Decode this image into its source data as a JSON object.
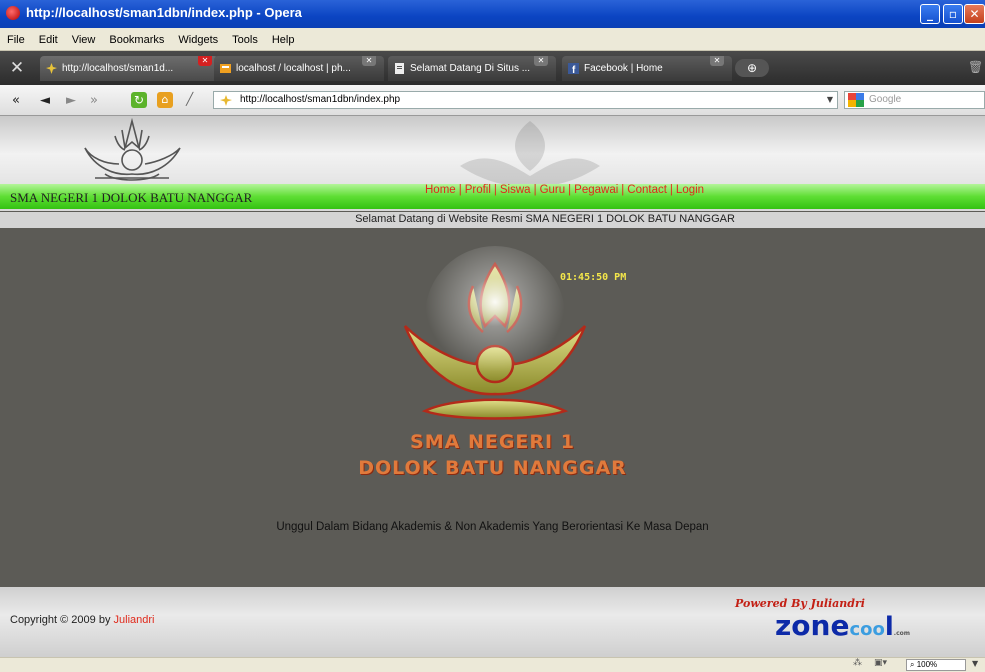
{
  "window": {
    "title": "http://localhost/sman1dbn/index.php - Opera"
  },
  "menu": [
    "File",
    "Edit",
    "View",
    "Bookmarks",
    "Widgets",
    "Tools",
    "Help"
  ],
  "tabs": [
    {
      "label": "http://localhost/sman1d...",
      "active": true
    },
    {
      "label": "localhost / localhost | ph...",
      "active": false
    },
    {
      "label": "Selamat Datang Di Situs ...",
      "active": false
    },
    {
      "label": "Facebook | Home",
      "active": false
    }
  ],
  "address": {
    "url": "http://localhost/sman1dbn/index.php",
    "search_placeholder": "Google"
  },
  "site": {
    "header_name": "SMA NEGERI 1 DOLOK BATU NANGGAR",
    "nav": [
      "Home",
      "Profil",
      "Siswa",
      "Guru",
      "Pegawai",
      "Contact",
      "Login"
    ],
    "nav_separator": "|",
    "welcome": "Selamat Datang di Website Resmi SMA NEGERI 1 DOLOK BATU NANGGAR",
    "clock": "01:45:50 PM",
    "title_line1": "SMA NEGERI 1",
    "title_line2": "DOLOK BATU NANGGAR",
    "motto": "Unggul Dalam Bidang Akademis & Non Akademis Yang Berorientasi Ke Masa Depan",
    "copyright_prefix": "Copyright © 2009 by",
    "copyright_author": "Juliandri",
    "powered_by": "Powered By Juliandri",
    "brand": {
      "zone": "zone",
      "c": "c",
      "oo": "oo",
      "l": "l",
      "dom": ".com"
    }
  },
  "status": {
    "zoom": "100%"
  },
  "colors": {
    "titlebar": "#0b44c2",
    "page_bg": "#5c5b56",
    "nav_link": "#e02a1c",
    "green_bar": "#5ede34",
    "clock": "#f4e64a",
    "title_orange": "#e07a3c",
    "brand_blue": "#0d2aa8"
  }
}
